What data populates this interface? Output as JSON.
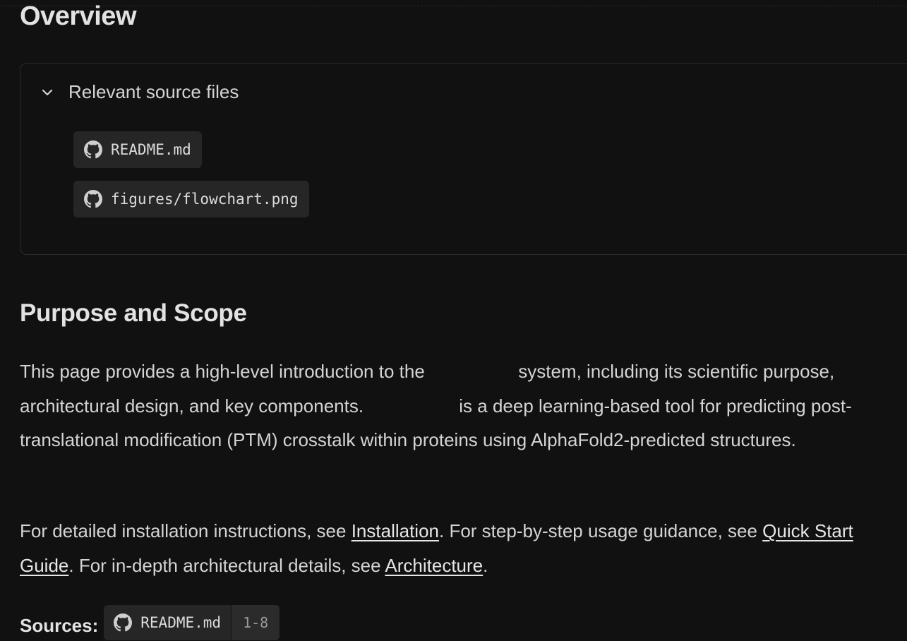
{
  "page": {
    "title": "Overview"
  },
  "relevant_sources": {
    "toggle_label": "Relevant source files",
    "toggle_icon": "chevron-down-icon",
    "files": [
      {
        "name": "README.md",
        "icon": "github-icon"
      },
      {
        "name": "figures/flowchart.png",
        "icon": "github-icon"
      }
    ]
  },
  "purpose": {
    "heading": "Purpose and Scope",
    "p1": {
      "t1": "This page provides a high-level introduction to the ",
      "t2": " system, including its scientific purpose, architectural design, and key components. ",
      "t3": "is a deep learning-based tool for predicting post-translational modification (PTM) crosstalk within proteins using AlphaFold2-predicted structures."
    },
    "p2": {
      "t1": "For detailed installation instructions, see ",
      "link1": "Installation",
      "t2": ". For step-by-step usage guidance, see ",
      "link2": "Quick Start Guide",
      "t3": ". For in-depth architectural details, see ",
      "link3": "Architecture",
      "t4": "."
    }
  },
  "sources": {
    "label": "Sources:",
    "file": "README.md",
    "range": "1-8",
    "icon": "github-icon"
  },
  "colors": {
    "background": "#111111",
    "chip": "#262626",
    "text": "#d4d4d4",
    "heading": "#e2e2e2"
  }
}
